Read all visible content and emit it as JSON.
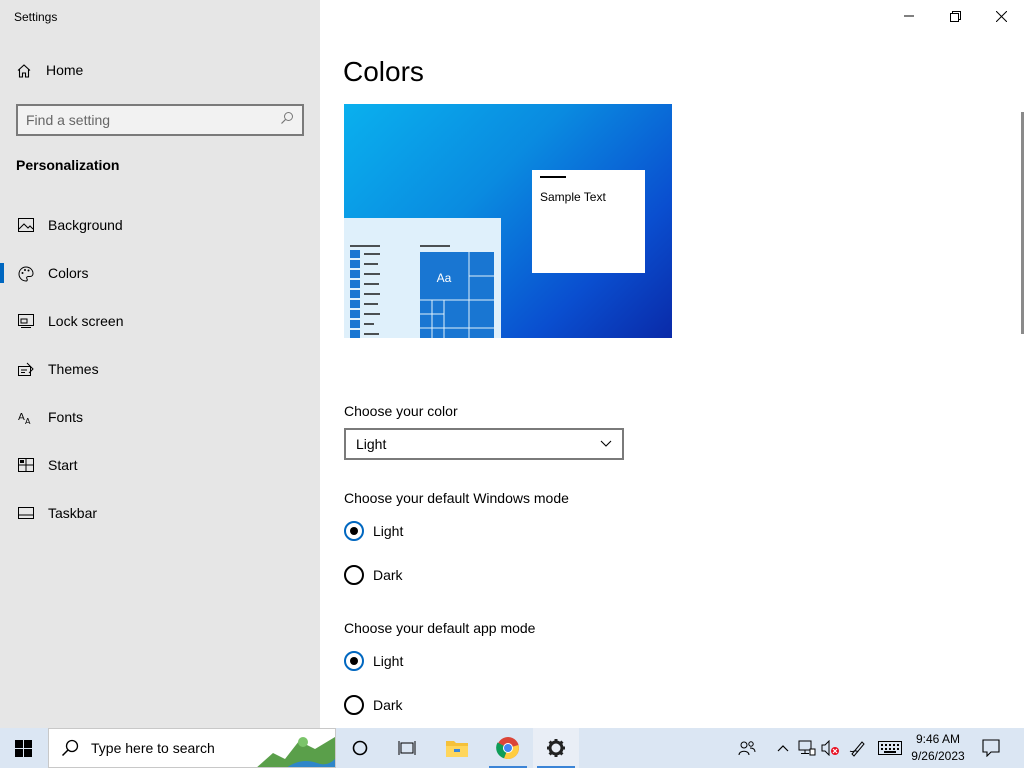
{
  "app": {
    "title": "Settings"
  },
  "sidebar": {
    "home_label": "Home",
    "search_placeholder": "Find a setting",
    "section_title": "Personalization",
    "items": [
      {
        "label": "Background",
        "icon": "image-icon"
      },
      {
        "label": "Colors",
        "icon": "palette-icon",
        "active": true
      },
      {
        "label": "Lock screen",
        "icon": "lock-screen-icon"
      },
      {
        "label": "Themes",
        "icon": "themes-icon"
      },
      {
        "label": "Fonts",
        "icon": "fonts-icon"
      },
      {
        "label": "Start",
        "icon": "start-icon"
      },
      {
        "label": "Taskbar",
        "icon": "taskbar-icon"
      }
    ]
  },
  "main": {
    "title": "Colors",
    "preview": {
      "sample_text": "Sample Text",
      "tile_text": "Aa"
    },
    "choose_color": {
      "label": "Choose your color",
      "value": "Light"
    },
    "windows_mode": {
      "label": "Choose your default Windows mode",
      "options": [
        {
          "label": "Light",
          "checked": true
        },
        {
          "label": "Dark",
          "checked": false
        }
      ]
    },
    "app_mode": {
      "label": "Choose your default app mode",
      "options": [
        {
          "label": "Light",
          "checked": true
        },
        {
          "label": "Dark",
          "checked": false
        }
      ]
    }
  },
  "taskbar": {
    "search_placeholder": "Type here to search",
    "time": "9:46 AM",
    "date": "9/26/2023"
  },
  "colors": {
    "accent": "#0067c0",
    "sidebar_bg": "#e6e6e6",
    "taskbar_bg": "#dbe6f3"
  }
}
